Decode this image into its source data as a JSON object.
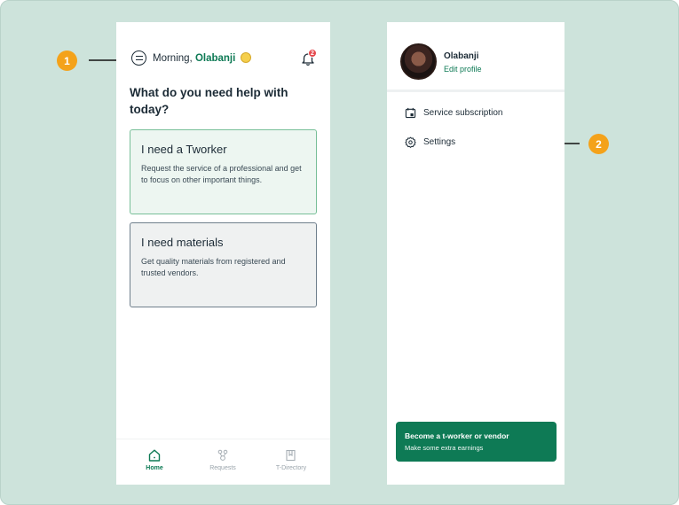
{
  "annotations": {
    "step1": "1",
    "step2": "2"
  },
  "home": {
    "greeting_prefix": "Morning,",
    "user_name": "Olabanji",
    "notification_count": "2",
    "question": "What do you need help with today?",
    "cards": [
      {
        "title": "I need a Tworker",
        "description": "Request the service of a professional and get to focus on other important things."
      },
      {
        "title": "I need materials",
        "description": "Get quality materials from registered and trusted vendors."
      }
    ],
    "nav": {
      "home": "Home",
      "requests": "Requests",
      "directory": "T-Directory"
    }
  },
  "drawer": {
    "profile_name": "Olabanji",
    "edit_profile": "Edit profile",
    "menu": {
      "subscription": "Service subscription",
      "settings": "Settings"
    },
    "cta": {
      "title": "Become a t-worker or vendor",
      "subtitle": "Make some extra earnings"
    }
  },
  "colors": {
    "brand_green": "#0e7a55",
    "annotation_orange": "#f4a21a",
    "background": "#cde3db"
  }
}
